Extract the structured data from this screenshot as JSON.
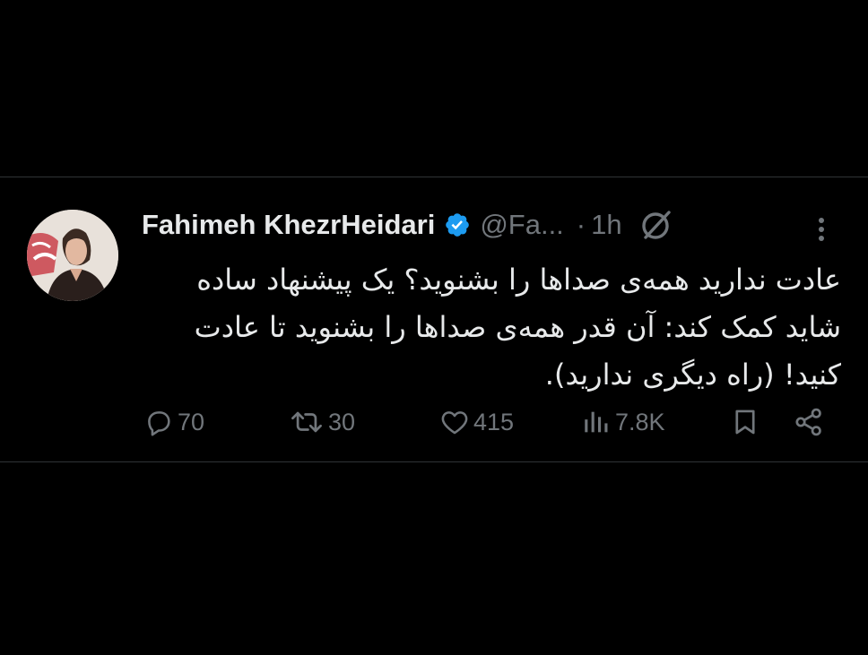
{
  "tweet": {
    "author": {
      "display_name": "Fahimeh KhezrHeidari",
      "handle": "@Fa...",
      "verified": true
    },
    "separator": "·",
    "time": "1h",
    "body_lines": [
      "عادت ندارید همه‌ی صداها را بشنوید؟ یک پیشنهاد ساده",
      "شاید کمک کند: آن قدر همه‌ی صداها را بشنوید تا عادت",
      "کنید! (راه دیگری ندارید)."
    ],
    "metrics": {
      "replies": "70",
      "reposts": "30",
      "likes": "415",
      "views": "7.8K"
    },
    "icons": {
      "verified": "verified-badge-icon",
      "grok": "grok-icon",
      "more": "more-vertical-icon",
      "reply": "reply-icon",
      "repost": "repost-icon",
      "like": "heart-icon",
      "views": "views-icon",
      "bookmark": "bookmark-icon",
      "share": "share-icon"
    },
    "colors": {
      "background": "#000000",
      "text": "#e7e9ea",
      "muted": "#71767b",
      "verified": "#1d9bf0",
      "divider": "#2f3336"
    }
  }
}
